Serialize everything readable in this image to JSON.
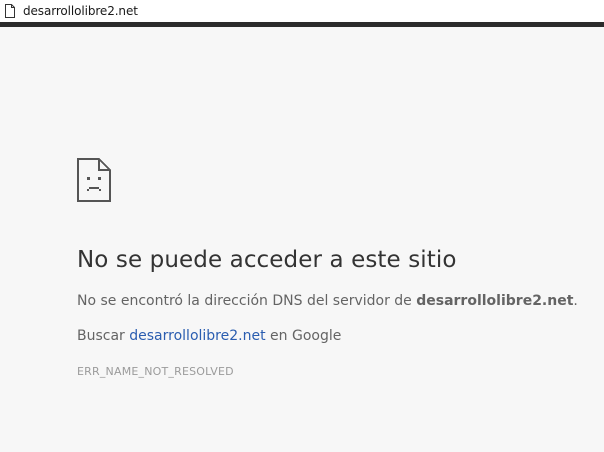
{
  "address_bar": {
    "url": "desarrollolibre2.net",
    "icon": "page-icon"
  },
  "error_page": {
    "icon": "sad-page-icon",
    "title": "No se puede acceder a este sitio",
    "description_prefix": "No se encontró la dirección DNS del servidor de ",
    "description_host": "desarrollolibre2.net",
    "description_suffix": ".",
    "search_prefix": "Buscar ",
    "search_link": "desarrollolibre2.net",
    "search_suffix": " en Google",
    "error_code": "ERR_NAME_NOT_RESOLVED",
    "colors": {
      "background": "#f7f7f7",
      "title": "#333333",
      "body": "#646464",
      "link": "#2a5db0",
      "code": "#9b9b9b"
    }
  }
}
